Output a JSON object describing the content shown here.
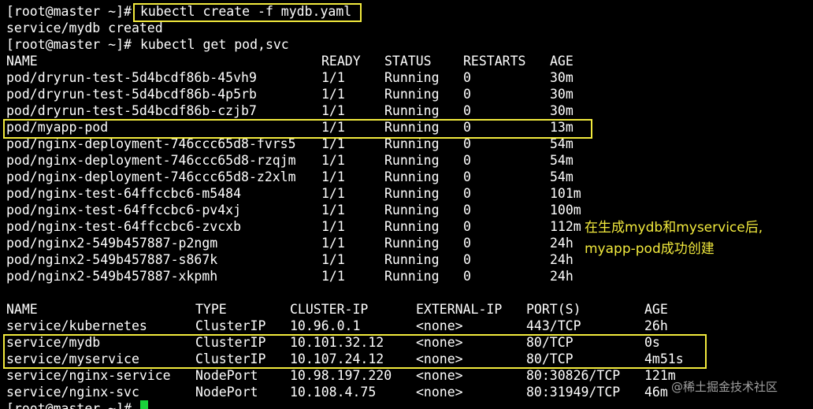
{
  "terminal": {
    "prompt": "[root@master ~]# ",
    "command1": "kubectl create -f mydb.yaml",
    "output1": "service/mydb created",
    "command2": "kubectl get pod,svc",
    "pod_headers": [
      "NAME",
      "READY",
      "STATUS",
      "RESTARTS",
      "AGE"
    ],
    "pods": [
      [
        "pod/dryrun-test-5d4bcdf86b-45vh9",
        "1/1",
        "Running",
        "0",
        "30m"
      ],
      [
        "pod/dryrun-test-5d4bcdf86b-4p5rb",
        "1/1",
        "Running",
        "0",
        "30m"
      ],
      [
        "pod/dryrun-test-5d4bcdf86b-czjb7",
        "1/1",
        "Running",
        "0",
        "30m"
      ],
      [
        "pod/myapp-pod",
        "1/1",
        "Running",
        "0",
        "13m"
      ],
      [
        "pod/nginx-deployment-746ccc65d8-fvrs5",
        "1/1",
        "Running",
        "0",
        "54m"
      ],
      [
        "pod/nginx-deployment-746ccc65d8-rzqjm",
        "1/1",
        "Running",
        "0",
        "54m"
      ],
      [
        "pod/nginx-deployment-746ccc65d8-z2xlm",
        "1/1",
        "Running",
        "0",
        "54m"
      ],
      [
        "pod/nginx-test-64ffccbc6-m5484",
        "1/1",
        "Running",
        "0",
        "101m"
      ],
      [
        "pod/nginx-test-64ffccbc6-pv4xj",
        "1/1",
        "Running",
        "0",
        "100m"
      ],
      [
        "pod/nginx-test-64ffccbc6-zvcxb",
        "1/1",
        "Running",
        "0",
        "112m"
      ],
      [
        "pod/nginx2-549b457887-p2ngm",
        "1/1",
        "Running",
        "0",
        "24h"
      ],
      [
        "pod/nginx2-549b457887-s867k",
        "1/1",
        "Running",
        "0",
        "24h"
      ],
      [
        "pod/nginx2-549b457887-xkpmh",
        "1/1",
        "Running",
        "0",
        "24h"
      ]
    ],
    "svc_headers": [
      "NAME",
      "TYPE",
      "CLUSTER-IP",
      "EXTERNAL-IP",
      "PORT(S)",
      "AGE"
    ],
    "services": [
      [
        "service/kubernetes",
        "ClusterIP",
        "10.96.0.1",
        "<none>",
        "443/TCP",
        "26h"
      ],
      [
        "service/mydb",
        "ClusterIP",
        "10.101.32.12",
        "<none>",
        "80/TCP",
        "0s"
      ],
      [
        "service/myservice",
        "ClusterIP",
        "10.107.24.12",
        "<none>",
        "80/TCP",
        "4m51s"
      ],
      [
        "service/nginx-service",
        "NodePort",
        "10.98.197.220",
        "<none>",
        "80:30826/TCP",
        "121m"
      ],
      [
        "service/nginx-svc",
        "NodePort",
        "10.108.4.75",
        "<none>",
        "80:31949/TCP",
        "46m"
      ]
    ],
    "final_prompt": "[root@master ~]# "
  },
  "annotation": {
    "line1": "在生成mydb和myservice后,",
    "line2": "myapp-pod成功创建"
  },
  "watermark": "@稀土掘金技术社区",
  "colors": {
    "background": "#000000",
    "text": "#ffffff",
    "highlight": "#f2ea3d",
    "cursor": "#19d23a"
  }
}
